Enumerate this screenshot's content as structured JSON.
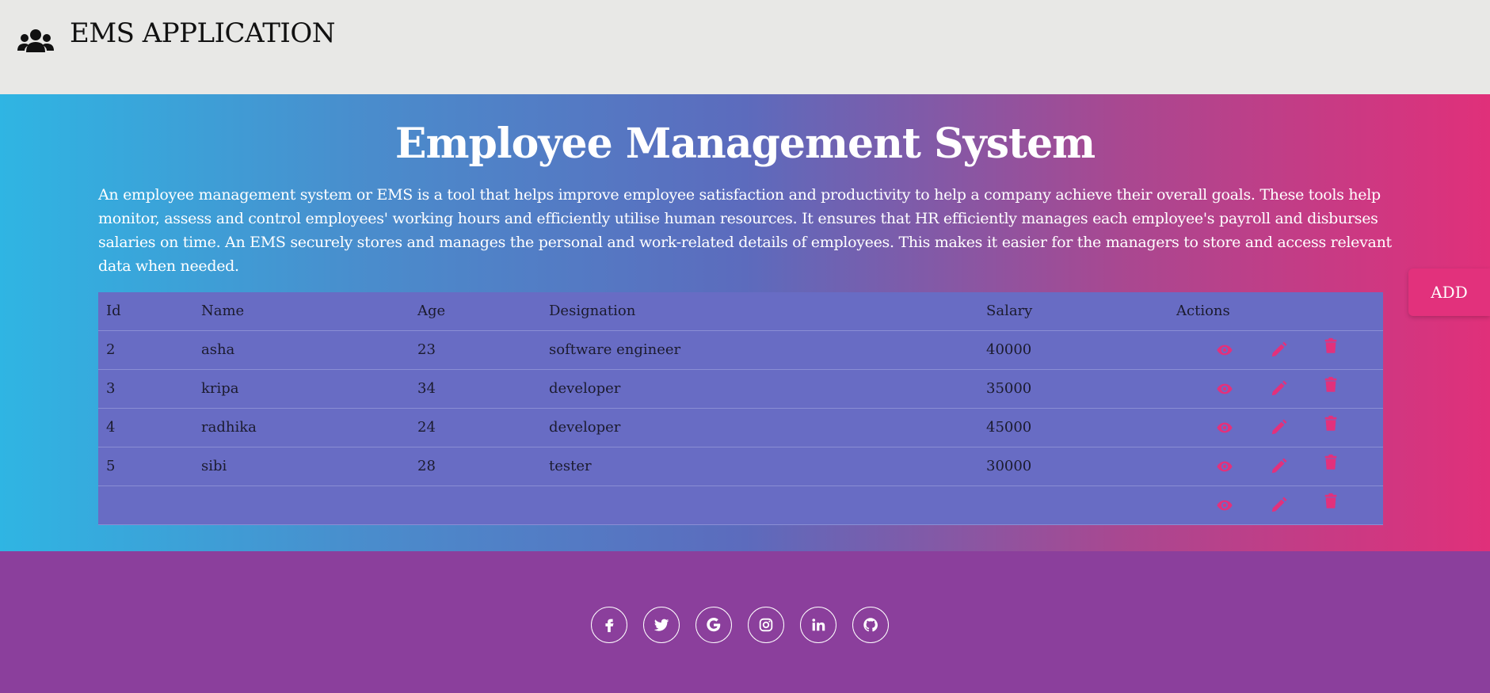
{
  "navbar": {
    "title": "EMS APPLICATION",
    "icon": "users-icon"
  },
  "hero": {
    "title": "Employee Management System",
    "description": "An employee management system or EMS is a tool that helps improve employee satisfaction and productivity to help a company achieve their overall goals. These tools help monitor, assess and control employees' working hours and efficiently utilise human resources. It ensures that HR efficiently manages each employee's payroll and disburses salaries on time. An EMS securely stores and manages the personal and work-related details of employees. This makes it easier for the managers to store and access relevant data when needed."
  },
  "add_button": {
    "label": "ADD"
  },
  "table": {
    "headers": [
      "Id",
      "Name",
      "Age",
      "Designation",
      "Salary",
      "Actions"
    ],
    "rows": [
      {
        "id": "2",
        "name": "asha",
        "age": "23",
        "designation": "software engineer",
        "salary": "40000"
      },
      {
        "id": "3",
        "name": "kripa",
        "age": "34",
        "designation": "developer",
        "salary": "35000"
      },
      {
        "id": "4",
        "name": "radhika",
        "age": "24",
        "designation": "developer",
        "salary": "45000"
      },
      {
        "id": "5",
        "name": "sibi",
        "age": "28",
        "designation": "tester",
        "salary": "30000"
      },
      {
        "id": "",
        "name": "",
        "age": "",
        "designation": "",
        "salary": ""
      }
    ],
    "action_icons": [
      "eye-icon",
      "pencil-icon",
      "trash-icon"
    ]
  },
  "footer": {
    "social_icons": [
      "facebook-icon",
      "twitter-icon",
      "google-icon",
      "instagram-icon",
      "linkedin-icon",
      "github-icon"
    ]
  },
  "colors": {
    "navbar_bg": "#e8e8e6",
    "accent": "#e2317c",
    "table_bg": "#686cc4",
    "footer_bg": "#8b3f9c",
    "gradient_start": "#2fb5e3",
    "gradient_end": "#e0307a"
  }
}
